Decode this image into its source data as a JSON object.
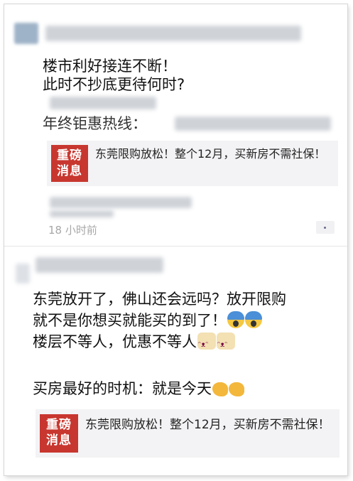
{
  "post1": {
    "lines": [
      "楼市利好接连不断！",
      "此时不抄底更待何时?",
      "年终钜惠热线："
    ],
    "card": {
      "badge_top": "重磅",
      "badge_bottom": "消息",
      "title": "东莞限购放松！整个12月，买新房不需社保！"
    },
    "time": "18 小时前"
  },
  "post2": {
    "line1": "东莞放开了，佛山还会远吗？放开限购",
    "line2": "就不是你想买就能买的到了！",
    "line3": "楼层不等人，优惠不等人",
    "line4": "买房最好的时机：就是今天",
    "card": {
      "badge_top": "重磅",
      "badge_bottom": "消息",
      "title": "东莞限购放松！整个12月，买新房不需社保！"
    }
  },
  "icons": {
    "scream": "face-screaming-emoji",
    "cat": "cat-face-emoji",
    "snail": "snail-emoji",
    "more": "more-dots-icon"
  }
}
